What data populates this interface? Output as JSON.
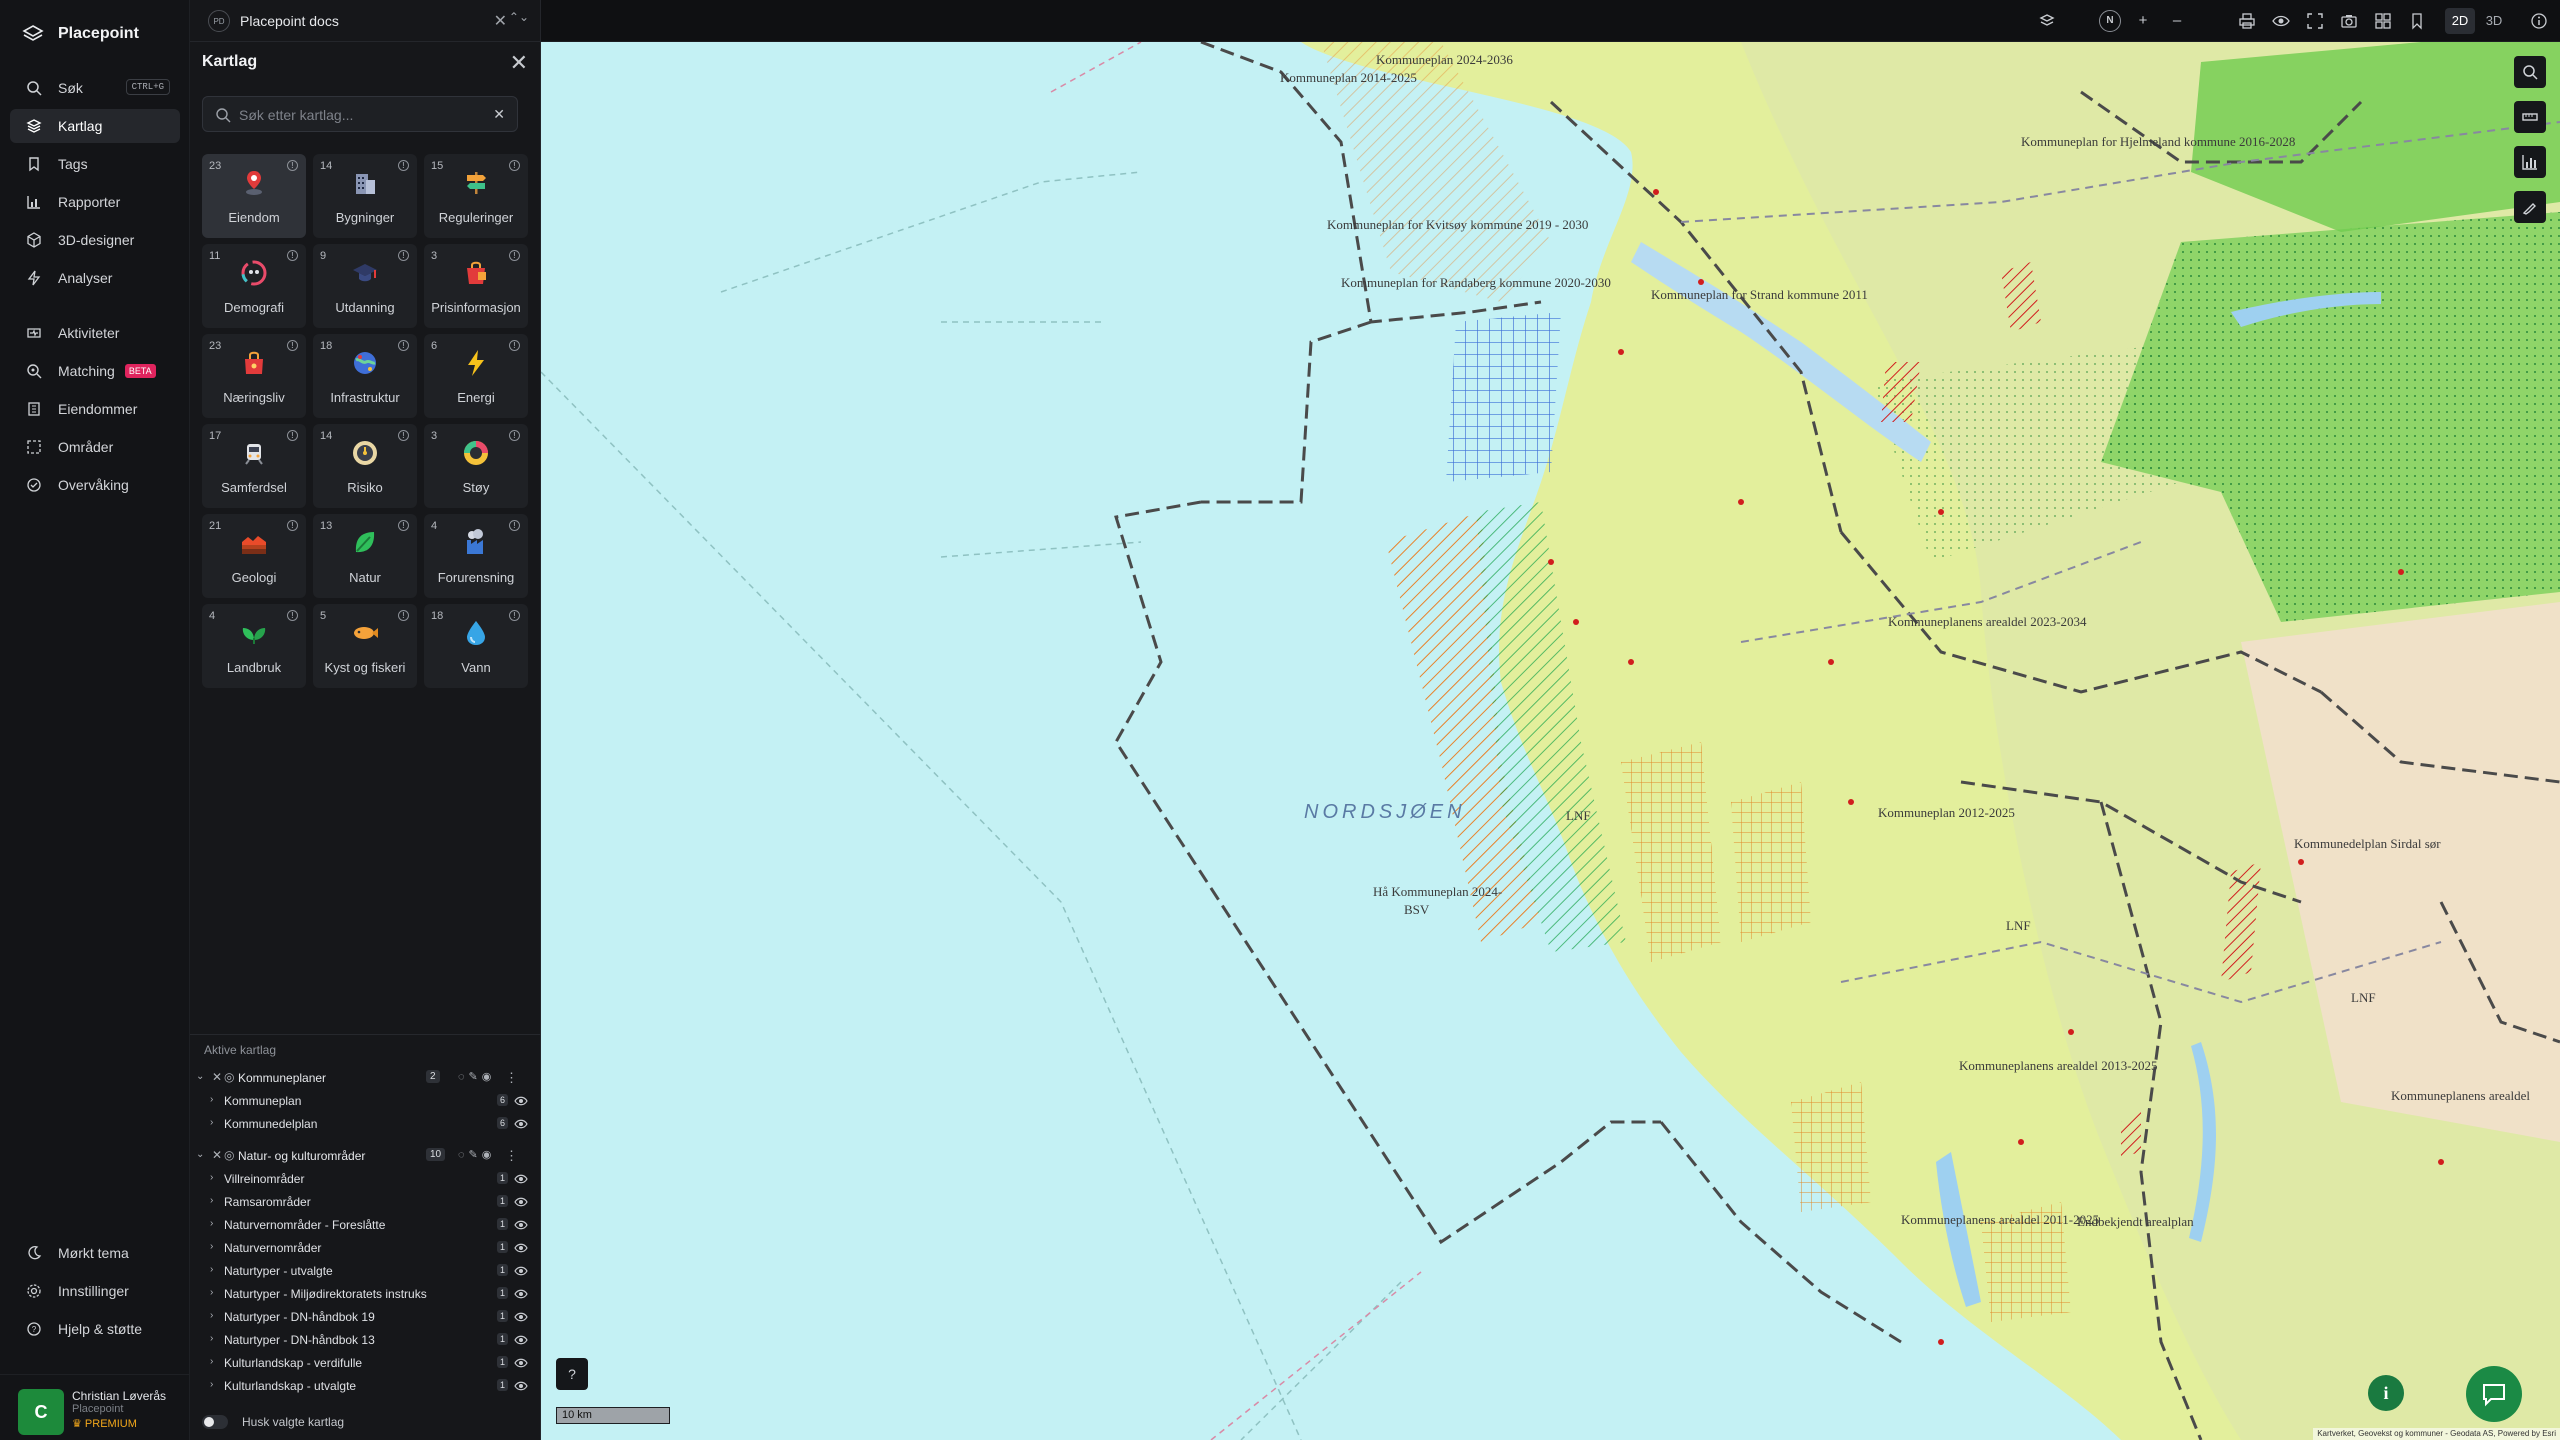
{
  "app": {
    "name": "Placepoint"
  },
  "nav": {
    "items": [
      {
        "label": "Søk",
        "shortcut": "CTRL+G",
        "icon": "search-icon"
      },
      {
        "label": "Kartlag",
        "icon": "layers-icon",
        "active": true
      },
      {
        "label": "Tags",
        "icon": "bookmark-icon"
      },
      {
        "label": "Rapporter",
        "icon": "bar-chart-icon"
      },
      {
        "label": "3D-designer",
        "icon": "cube-icon"
      },
      {
        "label": "Analyser",
        "icon": "bolt-icon"
      },
      {
        "label": "Aktiviteter",
        "icon": "activity-icon"
      },
      {
        "label": "Matching",
        "badge": "BETA",
        "icon": "match-search-icon"
      },
      {
        "label": "Eiendommer",
        "icon": "building-icon"
      },
      {
        "label": "Områder",
        "icon": "area-icon"
      },
      {
        "label": "Overvåking",
        "icon": "monitor-icon"
      }
    ],
    "bottom": [
      {
        "label": "Mørkt tema",
        "icon": "moon-icon"
      },
      {
        "label": "Innstillinger",
        "icon": "gear-icon"
      },
      {
        "label": "Hjelp & støtte",
        "icon": "help-icon"
      }
    ],
    "user": {
      "initial": "C",
      "name": "Christian Løverås",
      "org": "Placepoint",
      "plan": "PREMIUM"
    }
  },
  "doc_tab": {
    "badge": "PD",
    "name": "Placepoint docs"
  },
  "panel": {
    "title": "Kartlag",
    "search_placeholder": "Søk etter kartlag...",
    "categories": [
      {
        "count": "23",
        "label": "Eiendom",
        "icon": "property-pin-icon",
        "active": true
      },
      {
        "count": "14",
        "label": "Bygninger",
        "icon": "buildings-icon"
      },
      {
        "count": "15",
        "label": "Reguleringer",
        "icon": "signpost-icon"
      },
      {
        "count": "11",
        "label": "Demografi",
        "icon": "demography-icon"
      },
      {
        "count": "9",
        "label": "Utdanning",
        "icon": "graduation-cap-icon"
      },
      {
        "count": "3",
        "label": "Prisinformasjon",
        "icon": "shopping-bag-icon"
      },
      {
        "count": "23",
        "label": "Næringsliv",
        "icon": "business-bag-icon"
      },
      {
        "count": "18",
        "label": "Infrastruktur",
        "icon": "globe-network-icon"
      },
      {
        "count": "6",
        "label": "Energi",
        "icon": "lightning-icon"
      },
      {
        "count": "17",
        "label": "Samferdsel",
        "icon": "train-icon"
      },
      {
        "count": "14",
        "label": "Risiko",
        "icon": "risk-gauge-icon"
      },
      {
        "count": "3",
        "label": "Støy",
        "icon": "noise-icon"
      },
      {
        "count": "21",
        "label": "Geologi",
        "icon": "geology-icon"
      },
      {
        "count": "13",
        "label": "Natur",
        "icon": "leaf-icon"
      },
      {
        "count": "4",
        "label": "Forurensning",
        "icon": "factory-icon"
      },
      {
        "count": "4",
        "label": "Landbruk",
        "icon": "sprout-icon"
      },
      {
        "count": "5",
        "label": "Kyst og fiskeri",
        "icon": "fish-icon"
      },
      {
        "count": "18",
        "label": "Vann",
        "icon": "water-drop-icon"
      }
    ],
    "active_title": "Aktive kartlag",
    "groups": [
      {
        "name": "Kommuneplaner",
        "count": "2",
        "layers": [
          {
            "name": "Kommuneplan",
            "count": "6"
          },
          {
            "name": "Kommunedelplan",
            "count": "6"
          }
        ]
      },
      {
        "name": "Natur- og kulturområder",
        "count": "10",
        "layers": [
          {
            "name": "Villreinområder",
            "count": "1"
          },
          {
            "name": "Ramsarområder",
            "count": "1"
          },
          {
            "name": "Naturvernområder - Foreslåtte",
            "count": "1"
          },
          {
            "name": "Naturvernområder",
            "count": "1"
          },
          {
            "name": "Naturtyper - utvalgte",
            "count": "1"
          },
          {
            "name": "Naturtyper - Miljødirektoratets instruks",
            "count": "1"
          },
          {
            "name": "Naturtyper - DN-håndbok 19",
            "count": "1"
          },
          {
            "name": "Naturtyper - DN-håndbok 13",
            "count": "1"
          },
          {
            "name": "Kulturlandskap - verdifulle",
            "count": "1"
          },
          {
            "name": "Kulturlandskap - utvalgte",
            "count": "1"
          }
        ]
      }
    ],
    "remember_label": "Husk valgte kartlag"
  },
  "toolbar": {
    "north": "N",
    "zoom_in": "+",
    "zoom_out": "–",
    "view_2d": "2D",
    "view_3d": "3D"
  },
  "map": {
    "sea_label": "NORDSJØEN",
    "labels": [
      "Kommuneplan 2014-2025",
      "Kommuneplan 2024-2036",
      "Kommuneplan for Kvitsøy kommune 2019 - 2030",
      "Kommuneplan for Randaberg kommune 2020-2030",
      "Kommuneplan for Strand kommune 2011",
      "Kommuneplan for Hjelmeland kommune 2016-2028",
      "Kommuneplanens arealdel 2023-2034",
      "Kommuneplan 2012-2025",
      "Kommunedelplan Sirdal sør",
      "Hå Kommuneplan 2024-",
      "BSV",
      "Kommuneplanens arealdel 2013-2025",
      "Kommuneplanens arealdel 2011-2025",
      "Kommuneplanens arealdel",
      "Endbekjendt arealplan",
      "LNF",
      "LNF",
      "LNF"
    ],
    "scale_label": "10 km",
    "attribution": "Kartverket, Geovekst og kommuner - Geodata AS, Powered by Esri"
  }
}
